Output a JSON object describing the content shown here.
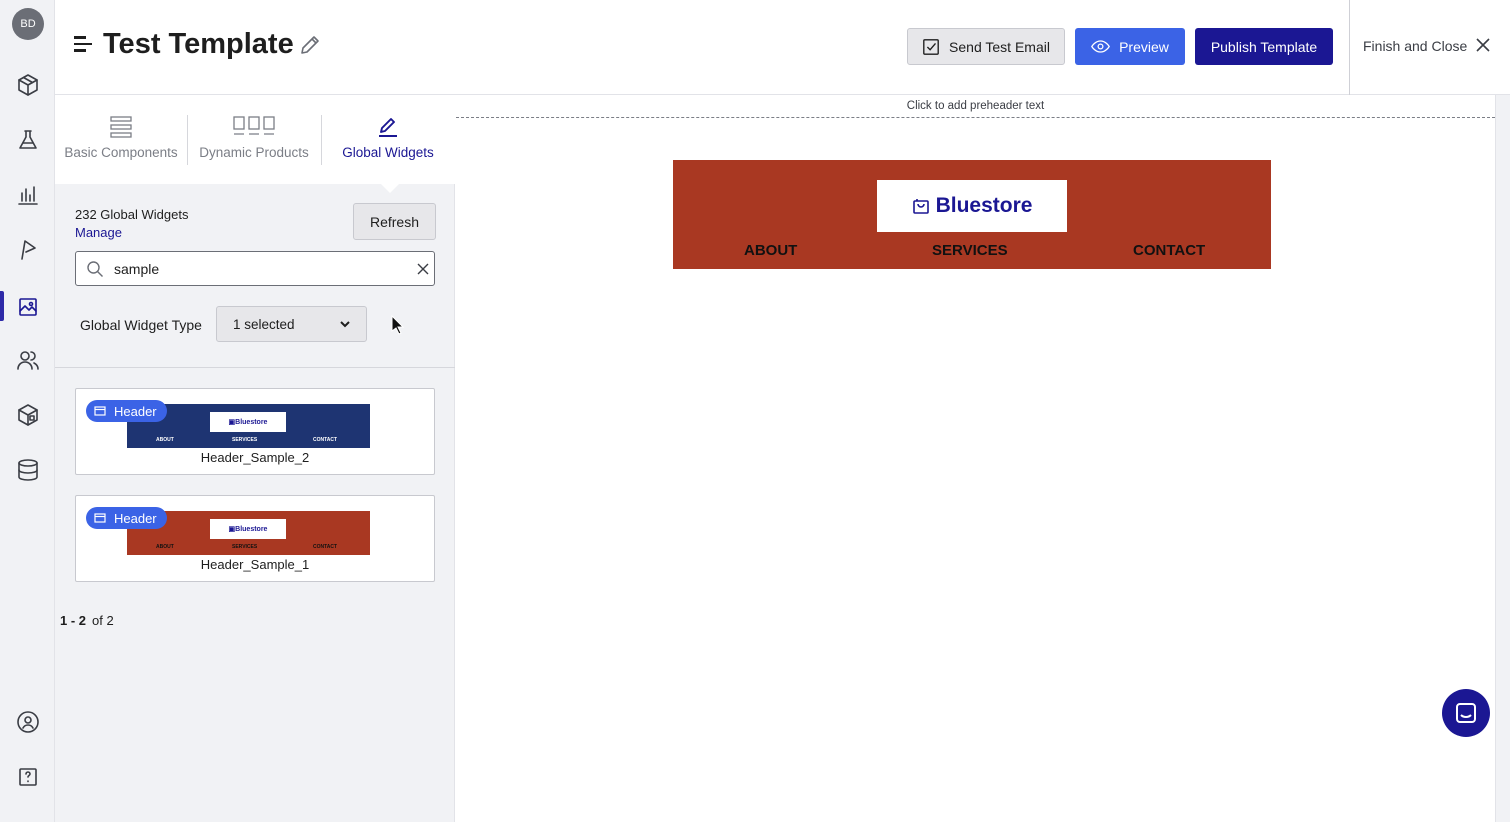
{
  "user": {
    "initials": "BD"
  },
  "header": {
    "title": "Test Template",
    "send_test_label": "Send Test Email",
    "preview_label": "Preview",
    "publish_label": "Publish Template",
    "finish_label": "Finish and Close"
  },
  "panel": {
    "tabs": [
      {
        "label": "Basic Components"
      },
      {
        "label": "Dynamic Products"
      },
      {
        "label": "Global Widgets"
      }
    ],
    "count_text": "232 Global Widgets",
    "manage_label": "Manage",
    "refresh_label": "Refresh",
    "search": {
      "value": "sample"
    },
    "type_filter": {
      "label": "Global Widget Type",
      "value": "1 selected"
    },
    "widgets": [
      {
        "badge": "Header",
        "name": "Header_Sample_2",
        "color": "#1e3472",
        "logo": "Bluestore",
        "nav": [
          "ABOUT",
          "SERVICES",
          "CONTACT"
        ]
      },
      {
        "badge": "Header",
        "name": "Header_Sample_1",
        "color": "#a93822",
        "logo": "Bluestore",
        "nav": [
          "ABOUT",
          "SERVICES",
          "CONTACT"
        ]
      }
    ],
    "pager": {
      "range": "1 - 2",
      "total": "of 2"
    }
  },
  "canvas": {
    "preheader": "Click to add preheader text",
    "email_header": {
      "color": "#a93822",
      "logo": "Bluestore",
      "nav": [
        "ABOUT",
        "SERVICES",
        "CONTACT"
      ]
    }
  },
  "colors": {
    "brand": "#1b1793",
    "accent": "#3b63e6"
  },
  "icons": [
    "box-icon",
    "flask-icon",
    "bar-chart-icon",
    "flag-icon",
    "image-icon",
    "users-icon",
    "package-icon",
    "database-icon",
    "help-circle-icon",
    "help-square-icon",
    "pencil-icon",
    "check-square-icon",
    "eye-icon",
    "close-icon",
    "search-icon",
    "chevron-down-icon",
    "chat-icon"
  ]
}
